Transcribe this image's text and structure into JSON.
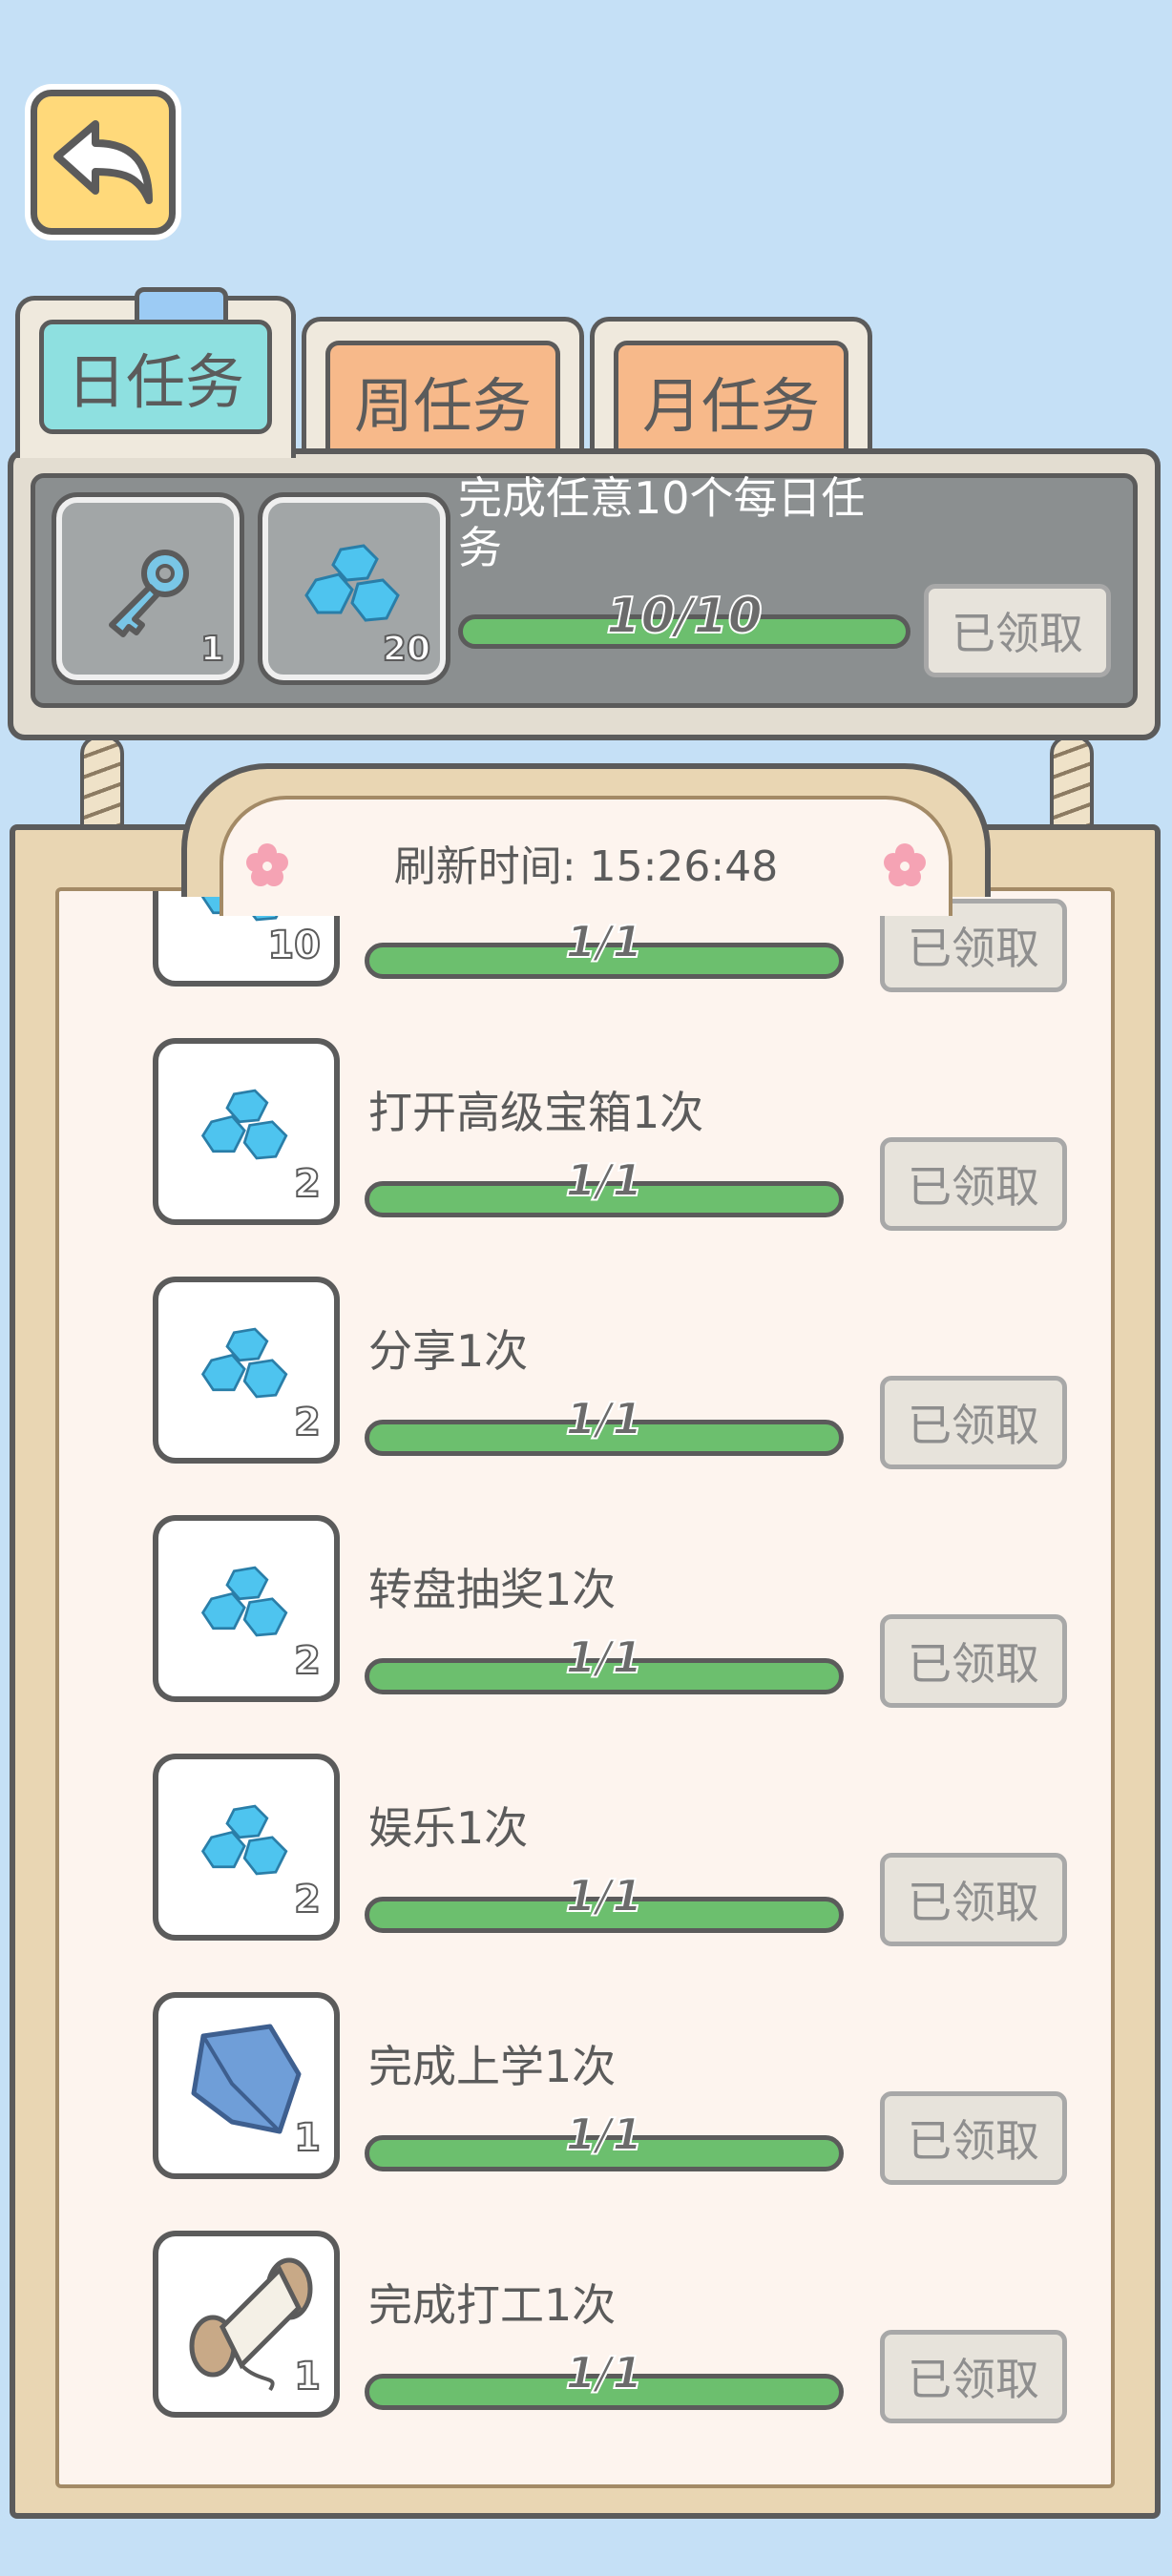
{
  "back_button": {
    "icon": "back-arrow-icon"
  },
  "tabs": [
    {
      "label": "日任务",
      "active": true
    },
    {
      "label": "周任务",
      "active": false
    },
    {
      "label": "月任务",
      "active": false
    }
  ],
  "summary": {
    "title": "完成任意10个每日任务",
    "progress_text": "10/10",
    "progress_fraction": 1.0,
    "status_label": "已领取",
    "rewards": [
      {
        "icon": "key-icon",
        "count": "1"
      },
      {
        "icon": "diamond-icon",
        "count": "20"
      }
    ]
  },
  "refresh": {
    "label": "刷新时间: 15:26:48"
  },
  "tasks": [
    {
      "title": "",
      "progress_text": "1/1",
      "status_label": "已领取",
      "reward_icon": "diamond-icon",
      "reward_count": "10"
    },
    {
      "title": "打开高级宝箱1次",
      "progress_text": "1/1",
      "status_label": "已领取",
      "reward_icon": "diamond-icon",
      "reward_count": "2"
    },
    {
      "title": "分享1次",
      "progress_text": "1/1",
      "status_label": "已领取",
      "reward_icon": "diamond-icon",
      "reward_count": "2"
    },
    {
      "title": "转盘抽奖1次",
      "progress_text": "1/1",
      "status_label": "已领取",
      "reward_icon": "diamond-icon",
      "reward_count": "2"
    },
    {
      "title": "娱乐1次",
      "progress_text": "1/1",
      "status_label": "已领取",
      "reward_icon": "diamond-icon",
      "reward_count": "2"
    },
    {
      "title": "完成上学1次",
      "progress_text": "1/1",
      "status_label": "已领取",
      "reward_icon": "cloth-icon",
      "reward_count": "1"
    },
    {
      "title": "完成打工1次",
      "progress_text": "1/1",
      "status_label": "已领取",
      "reward_icon": "thread-spool-icon",
      "reward_count": "1"
    }
  ],
  "colors": {
    "background": "#c5e0f6",
    "progress_fill": "#6cbf6e",
    "active_tab": "#8ee0e0",
    "inactive_tab": "#f7b98a",
    "back_button": "#ffd97a"
  }
}
